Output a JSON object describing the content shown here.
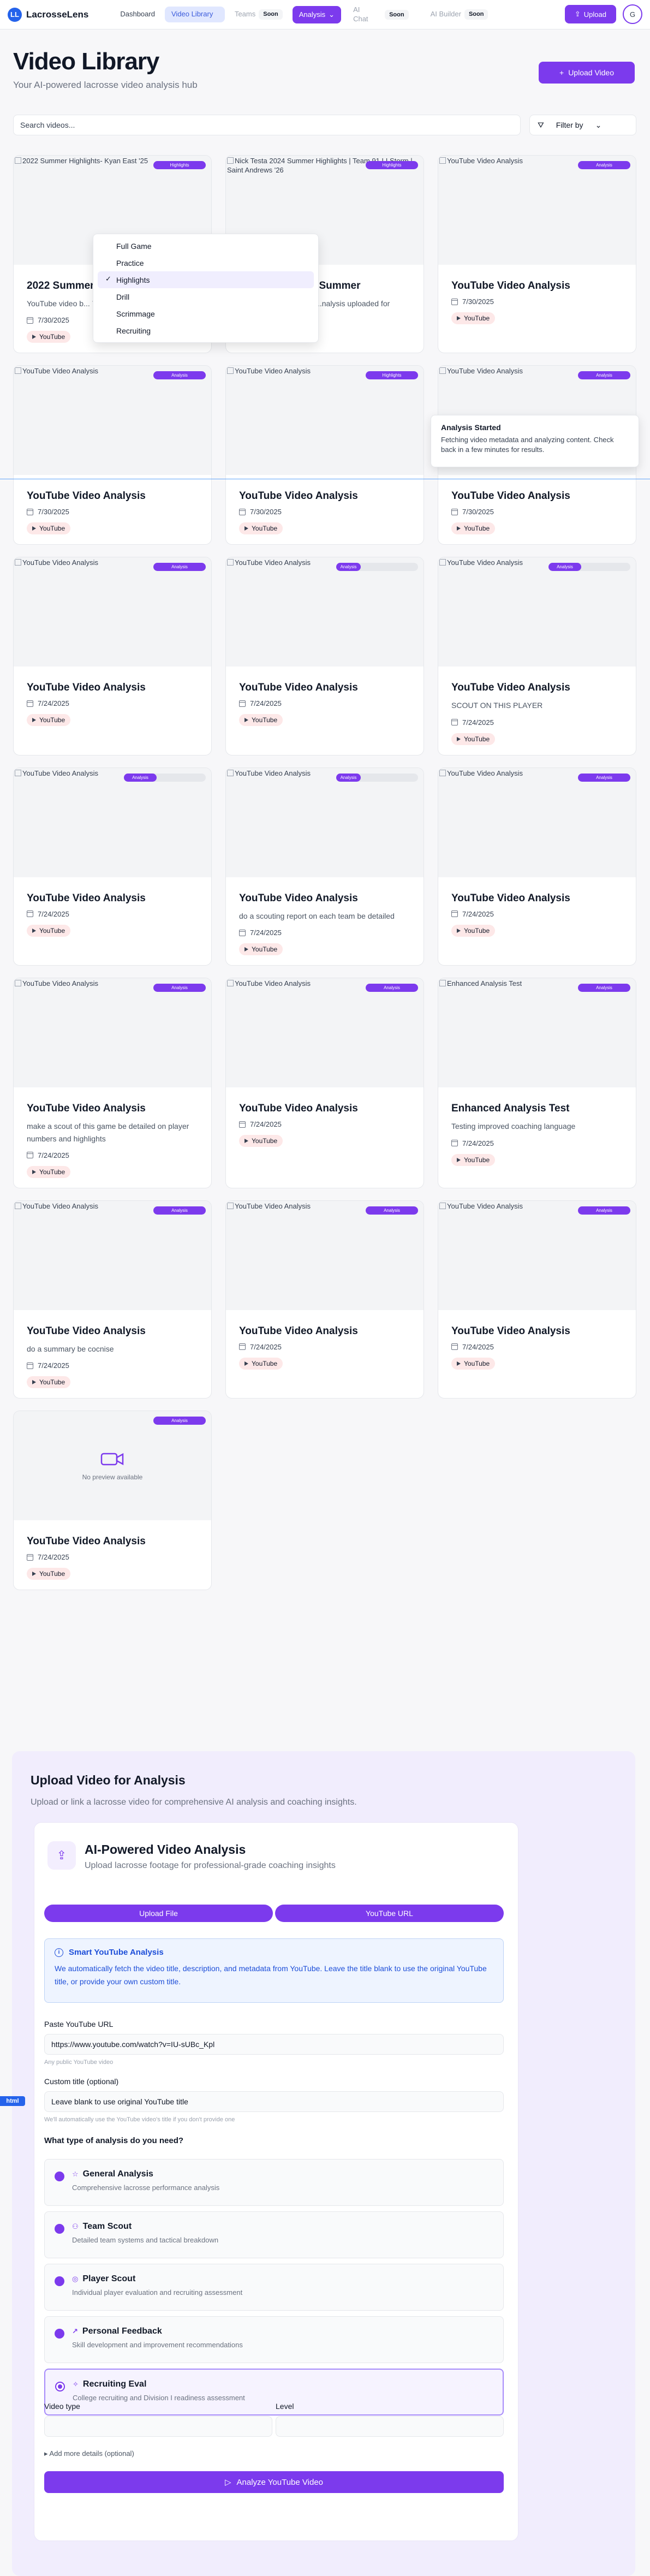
{
  "nav": {
    "logo_letter": "LL",
    "app_name": "LacrosseLens",
    "links": [
      {
        "label": "Dashboard"
      },
      {
        "label": "Video Library"
      },
      {
        "label": "Teams",
        "badge": "Soon"
      },
      {
        "label": "Analysis"
      },
      {
        "label": "AI Chat",
        "badge": "Soon"
      },
      {
        "label": "AI Builder",
        "badge": "Soon"
      }
    ],
    "upload_label": "Upload",
    "avatar_letter": "G"
  },
  "header": {
    "title": "Video Library",
    "subtitle": "Your AI-powered lacrosse video analysis hub",
    "upload_button": "Upload Video"
  },
  "search": {
    "placeholder": "Search videos..."
  },
  "filter": {
    "label": "Filter by"
  },
  "dropdown": {
    "options": [
      "Full Game",
      "Practice",
      "Highlights",
      "Drill",
      "Scrimmage",
      "Recruiting"
    ],
    "selected": "Highlights"
  },
  "toast": {
    "title": "Analysis Started",
    "message": "Fetching video metadata and analyzing content. Check back in a few minutes for results."
  },
  "cards": [
    {
      "alt": "2022 Summer Highlights- Kyan East '25",
      "title": "2022 Summer Highlights",
      "desc": "YouTube video b... 7/21/2025. Video...",
      "date": "7/30/2025",
      "source": "YouTube",
      "tag": "Highlights"
    },
    {
      "alt": "Nick Testa 2024 Summer Highlights | Team 91 LI Storm | Saint Andrews '26",
      "title": "Nick Testa 2024 Summer",
      "desc": "...ck Bilotta, published ...nalysis uploaded for",
      "date": "7/30/2025",
      "source": "YouTube",
      "tag": "Highlights"
    },
    {
      "alt": "YouTube Video Analysis",
      "title": "YouTube Video Analysis",
      "desc": "",
      "date": "7/30/2025",
      "source": "YouTube",
      "tag": "Analysis"
    },
    {
      "alt": "YouTube Video Analysis",
      "title": "YouTube Video Analysis",
      "desc": "",
      "date": "7/30/2025",
      "source": "YouTube",
      "tag": "Analysis"
    },
    {
      "alt": "YouTube Video Analysis",
      "title": "YouTube Video Analysis",
      "desc": "",
      "date": "7/30/2025",
      "source": "YouTube",
      "tag": "Highlights"
    },
    {
      "alt": "YouTube Video Analysis",
      "title": "YouTube Video Analysis",
      "desc": "",
      "date": "7/30/2025",
      "source": "YouTube",
      "tag": "Analysis"
    },
    {
      "alt": "YouTube Video Analysis",
      "title": "YouTube Video Analysis",
      "desc": "",
      "date": "7/24/2025",
      "source": "YouTube",
      "tag": "Analysis"
    },
    {
      "alt": "YouTube Video Analysis",
      "title": "YouTube Video Analysis",
      "desc": "",
      "date": "7/24/2025",
      "source": "YouTube",
      "tag": "Analysis",
      "progress": 0.3
    },
    {
      "alt": "YouTube Video Analysis",
      "title": "YouTube Video Analysis",
      "desc": "SCOUT ON THIS PLAYER",
      "date": "7/24/2025",
      "source": "YouTube",
      "tag": "Analysis",
      "progress": 0.4
    },
    {
      "alt": "YouTube Video Analysis",
      "title": "YouTube Video Analysis",
      "desc": "",
      "date": "7/24/2025",
      "source": "YouTube",
      "tag": "Analysis",
      "progress": 0.4
    },
    {
      "alt": "YouTube Video Analysis",
      "title": "YouTube Video Analysis",
      "desc": "do a scouting report on each team be detailed",
      "date": "7/24/2025",
      "source": "YouTube",
      "tag": "Analysis",
      "progress": 0.3
    },
    {
      "alt": "YouTube Video Analysis",
      "title": "YouTube Video Analysis",
      "desc": "",
      "date": "7/24/2025",
      "source": "YouTube",
      "tag": "Analysis"
    },
    {
      "alt": "YouTube Video Analysis",
      "title": "YouTube Video Analysis",
      "desc": "make a scout of this game be detailed on player numbers and highlights",
      "date": "7/24/2025",
      "source": "YouTube",
      "tag": "Analysis"
    },
    {
      "alt": "YouTube Video Analysis",
      "title": "YouTube Video Analysis",
      "desc": "",
      "date": "7/24/2025",
      "source": "YouTube",
      "tag": "Analysis"
    },
    {
      "alt": "Enhanced Analysis Test",
      "title": "Enhanced Analysis Test",
      "desc": "Testing improved coaching language",
      "date": "7/24/2025",
      "source": "YouTube",
      "tag": "Analysis"
    },
    {
      "alt": "YouTube Video Analysis",
      "title": "YouTube Video Analysis",
      "desc": "do a summary be cocnise",
      "date": "7/24/2025",
      "source": "YouTube",
      "tag": "Analysis"
    },
    {
      "alt": "YouTube Video Analysis",
      "title": "YouTube Video Analysis",
      "desc": "",
      "date": "7/24/2025",
      "source": "YouTube",
      "tag": "Analysis"
    },
    {
      "alt": "YouTube Video Analysis",
      "title": "YouTube Video Analysis",
      "desc": "",
      "date": "7/24/2025",
      "source": "YouTube",
      "tag": "Analysis"
    },
    {
      "alt": "",
      "title": "YouTube Video Analysis",
      "desc": "",
      "date": "7/24/2025",
      "source": "YouTube",
      "tag": "Analysis",
      "no_preview": "No preview available"
    }
  ],
  "upload": {
    "title": "Upload Video for Analysis",
    "subtitle": "Upload or link a lacrosse video for comprehensive AI analysis and coaching insights.",
    "card_title": "AI-Powered Video Analysis",
    "card_subtitle": "Upload lacrosse footage for professional-grade coaching insights",
    "tab_file": "Upload File",
    "tab_url": "YouTube URL",
    "info_title": "Smart YouTube Analysis",
    "info_text": "We automatically fetch the video title, description, and metadata from YouTube. Leave the title blank to use the original YouTube title, or provide your own custom title.",
    "url_label": "Paste YouTube URL",
    "url_value": "https://www.youtube.com/watch?v=IU-sUBc_Kpl",
    "url_hint": "Any public YouTube video",
    "custom_label": "Custom title (optional)",
    "custom_placeholder": "Leave blank to use original YouTube title",
    "custom_hint": "We'll automatically use the YouTube video's title if you don't provide one",
    "question": "What type of analysis do you need?",
    "options": [
      {
        "title": "General Analysis",
        "desc": "Comprehensive lacrosse performance analysis",
        "icon": "☆"
      },
      {
        "title": "Team Scout",
        "desc": "Detailed team systems and tactical breakdown",
        "icon": "⚇"
      },
      {
        "title": "Player Scout",
        "desc": "Individual player evaluation and recruiting assessment",
        "icon": "◎"
      },
      {
        "title": "Personal Feedback",
        "desc": "Skill development and improvement recommendations",
        "icon": "↗"
      },
      {
        "title": "Recruiting Eval",
        "desc": "College recruiting and Division I readiness assessment",
        "icon": "✧"
      }
    ],
    "selected_option": "Recruiting Eval",
    "video_type_label": "Video type",
    "level_label": "Level",
    "more_details": "▸  Add more details (optional)",
    "analyze_button": "Analyze YouTube Video"
  },
  "debug_badge": "html",
  "colors": {
    "accent": "#7c3aed",
    "brand_blue": "#2563eb",
    "yt_pill": "#fde8e8"
  }
}
